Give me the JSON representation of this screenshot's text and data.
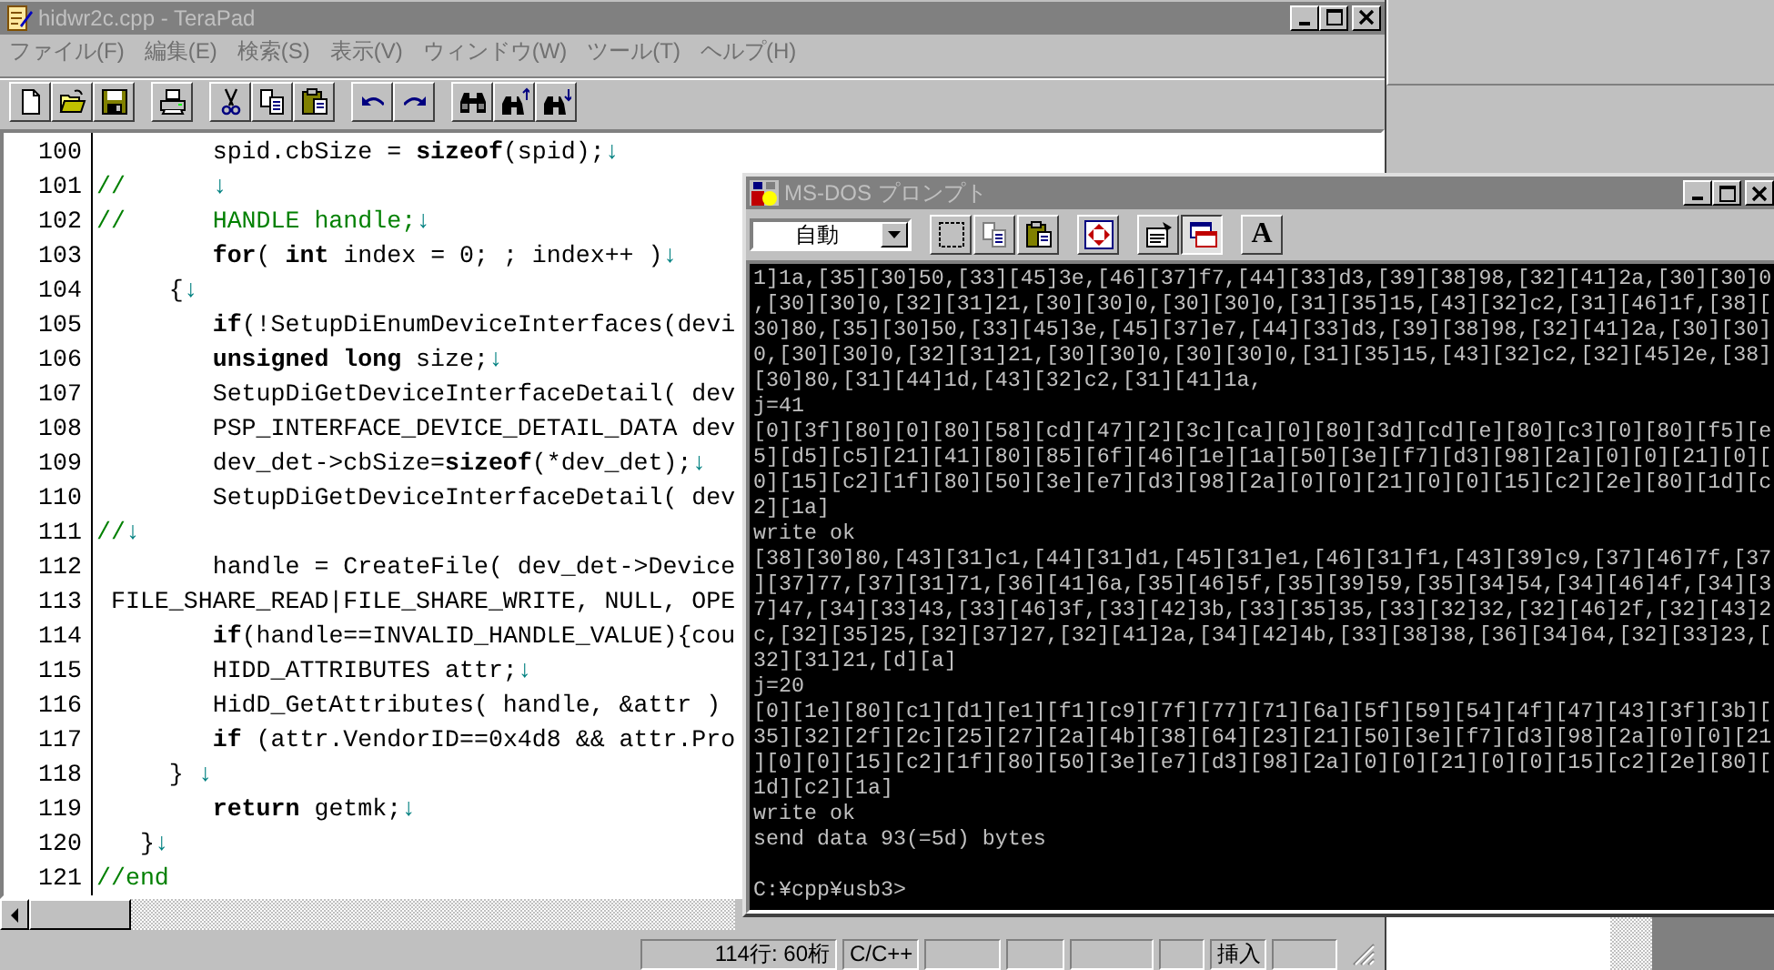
{
  "editor": {
    "title": "hidwr2c.cpp - TeraPad",
    "menu": [
      "ファイル(F)",
      "編集(E)",
      "検索(S)",
      "表示(V)",
      "ウィンドウ(W)",
      "ツール(T)",
      "ヘルプ(H)"
    ],
    "lines": [
      {
        "number": "100",
        "text": "        spid.cbSize = **sizeof**(spid);",
        "comment": false,
        "eol": "↓"
      },
      {
        "number": "101",
        "text": "//      ",
        "comment": true,
        "eol": "↓"
      },
      {
        "number": "102",
        "text": "//      HANDLE handle;",
        "comment": true,
        "eol": "↓"
      },
      {
        "number": "103",
        "text": "        **for**( **int** index = 0; ; index++ )",
        "comment": false,
        "eol": "↓"
      },
      {
        "number": "104",
        "text": "     {",
        "comment": false,
        "eol": "↓"
      },
      {
        "number": "105",
        "text": "        **if**(!SetupDiEnumDeviceInterfaces(devi",
        "comment": false
      },
      {
        "number": "106",
        "text": "        **unsigned long** size;",
        "comment": false,
        "eol": "↓"
      },
      {
        "number": "107",
        "text": "        SetupDiGetDeviceInterfaceDetail( dev",
        "comment": false
      },
      {
        "number": "108",
        "text": "        PSP_INTERFACE_DEVICE_DETAIL_DATA dev",
        "comment": false
      },
      {
        "number": "109",
        "text": "        dev_det->cbSize=**sizeof**(*dev_det);",
        "comment": false,
        "eol": "↓"
      },
      {
        "number": "110",
        "text": "        SetupDiGetDeviceInterfaceDetail( dev",
        "comment": false
      },
      {
        "number": "111",
        "text": "//",
        "comment": true,
        "eol": "↓"
      },
      {
        "number": "112",
        "text": "        handle = CreateFile( dev_det->Device",
        "comment": false
      },
      {
        "number": "113",
        "text": " FILE_SHARE_READ|FILE_SHARE_WRITE, NULL, OPE",
        "comment": false
      },
      {
        "number": "114",
        "text": "        **if**(handle==INVALID_HANDLE_VALUE){cou",
        "comment": false
      },
      {
        "number": "115",
        "text": "        HIDD_ATTRIBUTES attr;",
        "comment": false,
        "eol": "↓"
      },
      {
        "number": "116",
        "text": "        HidD_GetAttributes( handle, &attr )",
        "comment": false
      },
      {
        "number": "117",
        "text": "        **if** (attr.VendorID==0x4d8 && attr.Pro",
        "comment": false
      },
      {
        "number": "118",
        "text": "     } ",
        "comment": false,
        "eol": "↓"
      },
      {
        "number": "119",
        "text": "        **return** getmk;",
        "comment": false,
        "eol": "↓"
      },
      {
        "number": "120",
        "text": "   }",
        "comment": false,
        "eol": "↓"
      },
      {
        "number": "121",
        "text": "//end",
        "comment": true
      }
    ],
    "status_bar": [
      {
        "kind": "text",
        "text": "114行: 60桁"
      },
      {
        "kind": "text",
        "text": "C/C++"
      },
      {
        "kind": "blank"
      },
      {
        "kind": "blank"
      },
      {
        "kind": "blank"
      },
      {
        "kind": "blank"
      },
      {
        "kind": "text",
        "text": "挿入"
      },
      {
        "kind": "blank"
      }
    ]
  },
  "dos_window": {
    "title": "MS-DOS プロンプト",
    "dropdown": {
      "value": "自動"
    },
    "font_button": "A",
    "output": [
      "1]1a,[35][30]50,[33][45]3e,[46][37]f7,[44][33]d3,[39][38]98,[32][41]2a,[30][30]0",
      ",[30][30]0,[32][31]21,[30][30]0,[30][30]0,[31][35]15,[43][32]c2,[31][46]1f,[38][",
      "30]80,[35][30]50,[33][45]3e,[45][37]e7,[44][33]d3,[39][38]98,[32][41]2a,[30][30]",
      "0,[30][30]0,[32][31]21,[30][30]0,[30][30]0,[31][35]15,[43][32]c2,[32][45]2e,[38]",
      "[30]80,[31][44]1d,[43][32]c2,[31][41]1a,",
      "j=41",
      "[0][3f][80][0][80][58][cd][47][2][3c][ca][0][80][3d][cd][e][80][c3][0][80][f5][e",
      "5][d5][c5][21][41][80][85][6f][46][1e][1a][50][3e][f7][d3][98][2a][0][0][21][0][",
      "0][15][c2][1f][80][50][3e][e7][d3][98][2a][0][0][21][0][0][15][c2][2e][80][1d][c",
      "2][1a]",
      "write ok",
      "[38][30]80,[43][31]c1,[44][31]d1,[45][31]e1,[46][31]f1,[43][39]c9,[37][46]7f,[37",
      "][37]77,[37][31]71,[36][41]6a,[35][46]5f,[35][39]59,[35][34]54,[34][46]4f,[34][3",
      "7]47,[34][33]43,[33][46]3f,[33][42]3b,[33][35]35,[33][32]32,[32][46]2f,[32][43]2",
      "c,[32][35]25,[32][37]27,[32][41]2a,[34][42]4b,[33][38]38,[36][34]64,[32][33]23,[",
      "32][31]21,[d][a]",
      "j=20",
      "[0][1e][80][c1][d1][e1][f1][c9][7f][77][71][6a][5f][59][54][4f][47][43][3f][3b][",
      "35][32][2f][2c][25][27][2a][4b][38][64][23][21][50][3e][f7][d3][98][2a][0][0][21",
      "][0][0][15][c2][1f][80][50][3e][e7][d3][98][2a][0][0][21][0][0][15][c2][2e][80][",
      "1d][c2][1a]",
      "write ok",
      "send data 93(=5d) bytes"
    ],
    "prompt": "C:¥cpp¥usb3>"
  }
}
